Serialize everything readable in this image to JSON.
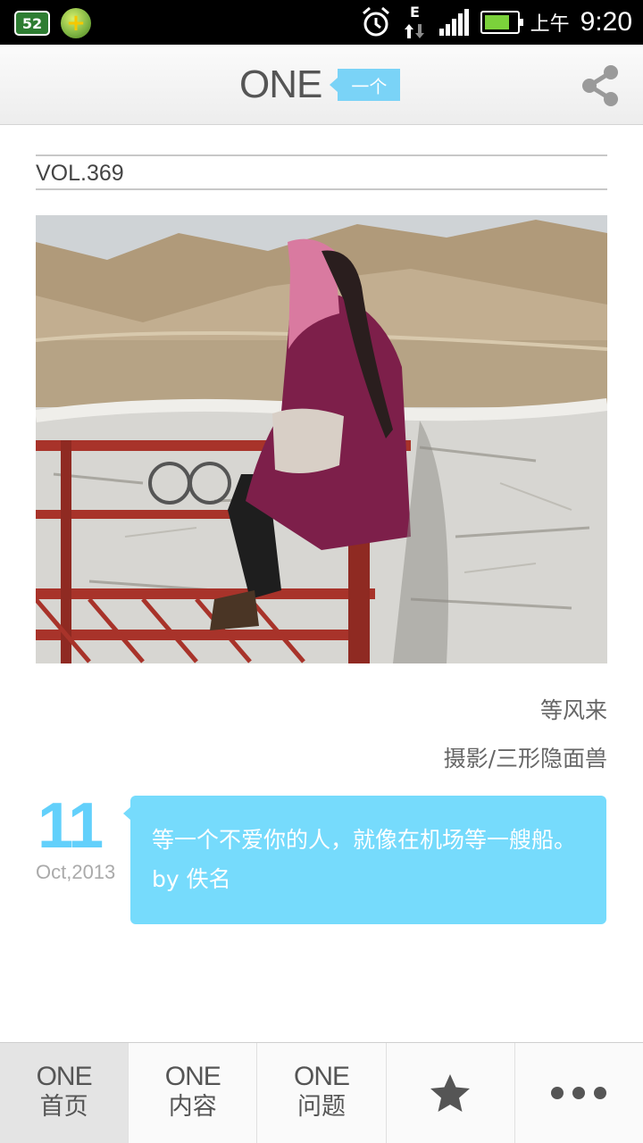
{
  "status_bar": {
    "badge_text": "52",
    "time_prefix": "上午",
    "time": "9:20",
    "network": "E",
    "battery_level": 0.8,
    "icons": [
      "mobile-badge-icon",
      "security-plus-icon",
      "alarm-icon",
      "data-transfer-icon",
      "signal-icon",
      "battery-icon"
    ]
  },
  "header": {
    "logo": "ONE",
    "tag": "一个",
    "share_icon": "share-icon"
  },
  "content": {
    "vol": "VOL.369",
    "photo_alt_icon": "photo",
    "caption_title": "等风来",
    "caption_author": "摄影/三形隐面兽",
    "date_day": "11",
    "date_month": "Oct,2013",
    "quote": "等一个不爱你的人，就像在机场等一艘船。by 佚名"
  },
  "nav": {
    "items": [
      {
        "top": "ONE",
        "bottom": "首页",
        "active": true
      },
      {
        "top": "ONE",
        "bottom": "内容",
        "active": false
      },
      {
        "top": "ONE",
        "bottom": "问题",
        "active": false
      },
      {
        "icon": "star-icon"
      },
      {
        "icon": "more-icon"
      }
    ]
  },
  "colors": {
    "accent": "#76dbfc",
    "date_blue": "#62d0fb",
    "text_dark": "#555555"
  }
}
